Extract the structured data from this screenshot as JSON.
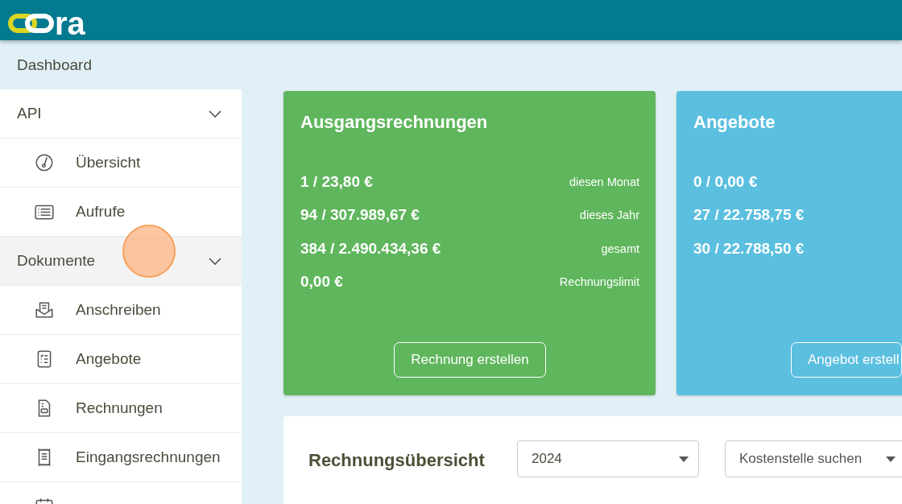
{
  "header": {
    "logo_bottom": "ra"
  },
  "breadcrumb": "Dashboard",
  "sidebar": {
    "items": [
      {
        "kind": "group",
        "label": "API",
        "expanded": true,
        "highlighted": false
      },
      {
        "kind": "item",
        "label": "Übersicht",
        "highlighted": false
      },
      {
        "kind": "item",
        "label": "Aufrufe",
        "highlighted": false
      },
      {
        "kind": "group",
        "label": "Dokumente",
        "expanded": true,
        "highlighted": true
      },
      {
        "kind": "item",
        "label": "Anschreiben",
        "highlighted": false
      },
      {
        "kind": "item",
        "label": "Angebote",
        "highlighted": false
      },
      {
        "kind": "item",
        "label": "Rechnungen",
        "highlighted": false
      },
      {
        "kind": "item",
        "label": "Eingangsrechnungen",
        "highlighted": false
      },
      {
        "kind": "item",
        "highlighted": false
      }
    ]
  },
  "cards": [
    {
      "title": "Ausgangsrechnungen",
      "color": "#5fb65c",
      "rows": [
        {
          "value": "1 / 23,80 €",
          "label": "diesen Monat"
        },
        {
          "value": "94 / 307.989,67 €",
          "label": "dieses Jahr"
        },
        {
          "value": "384 / 2.490.434,36 €",
          "label": "gesamt"
        },
        {
          "value": "0,00 €",
          "label": "Rechnungslimit"
        }
      ],
      "button": "Rechnung erstellen"
    },
    {
      "title": "Angebote",
      "color": "#5bbfe0",
      "rows": [
        {
          "value": "0 / 0,00 €"
        },
        {
          "value": "27 / 22.758,75 €"
        },
        {
          "value": "30 / 22.788,50 €"
        }
      ],
      "button": "Angebot erstell"
    }
  ],
  "overview": {
    "title": "Rechnungsübersicht",
    "year_select": {
      "value": "2024"
    },
    "cost_center_select": {
      "placeholder": "Kostenstelle suchen"
    }
  }
}
